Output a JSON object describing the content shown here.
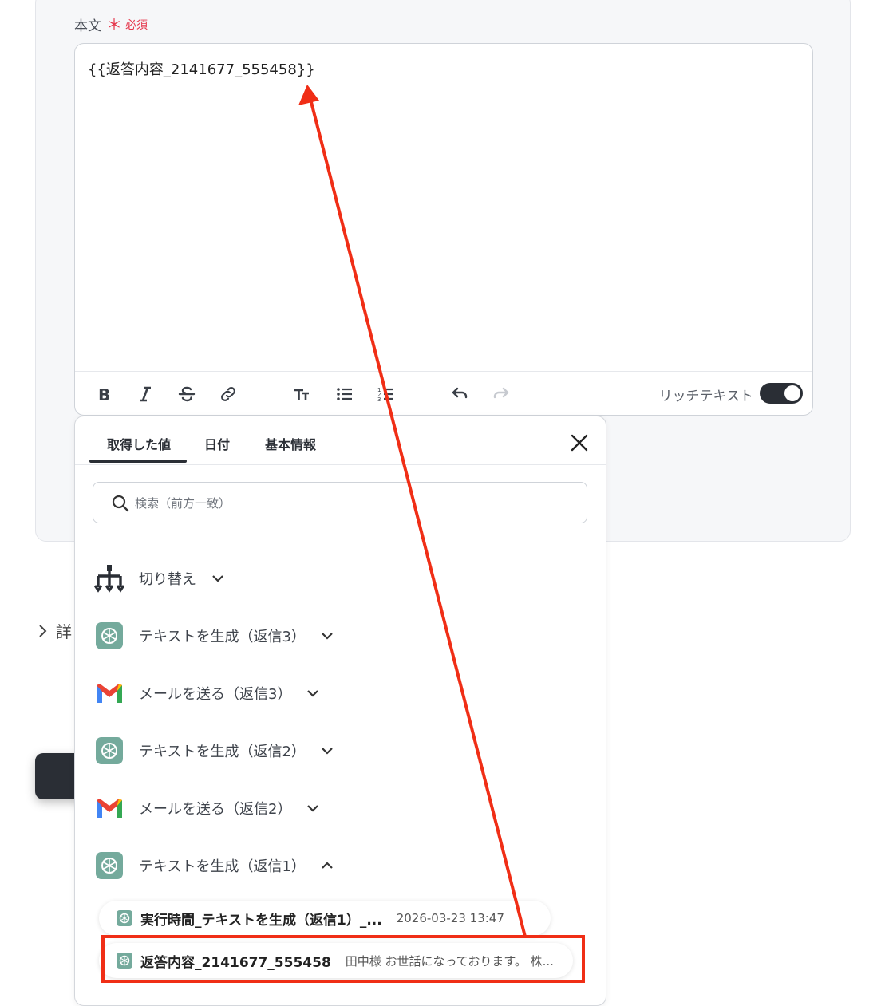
{
  "field": {
    "label": "本文",
    "required_mark": "＊",
    "required_text": "必須"
  },
  "editor": {
    "content": "{{返答内容_2141677_555458}}",
    "rich_text_label": "リッチテキスト",
    "rich_text_enabled": true
  },
  "toolbar": {
    "buttons": [
      "bold-icon",
      "italic-icon",
      "strikethrough-icon",
      "link-icon",
      "text-size-icon",
      "bullet-list-icon",
      "numbered-list-icon",
      "undo-icon",
      "redo-icon"
    ]
  },
  "detail": {
    "label": "詳"
  },
  "popup": {
    "tabs": [
      {
        "label": "取得した値",
        "active": true
      },
      {
        "label": "日付",
        "active": false
      },
      {
        "label": "基本情報",
        "active": false
      }
    ],
    "search_placeholder": "検索（前方一致）",
    "groups": [
      {
        "label": "切り替え",
        "icon": "branch-icon",
        "expanded": false
      },
      {
        "label": "テキストを生成（返信3）",
        "icon": "chatgpt-icon",
        "expanded": false
      },
      {
        "label": "メールを送る（返信3）",
        "icon": "gmail-icon",
        "expanded": false
      },
      {
        "label": "テキストを生成（返信2）",
        "icon": "chatgpt-icon",
        "expanded": false
      },
      {
        "label": "メールを送る（返信2）",
        "icon": "gmail-icon",
        "expanded": false
      },
      {
        "label": "テキストを生成（返信1）",
        "icon": "chatgpt-icon",
        "expanded": true
      }
    ],
    "items": [
      {
        "name": "実行時間_テキストを生成（返信1）_...",
        "value": "2026-03-23 13:47"
      },
      {
        "name": "返答内容_2141677_555458",
        "value": "田中様 お世話になっております。 株..."
      }
    ]
  },
  "colors": {
    "accent_dark": "#2a2e35",
    "required": "#e5364b",
    "annotation": "#f02e16",
    "chatgpt_green": "#74aa9c"
  }
}
